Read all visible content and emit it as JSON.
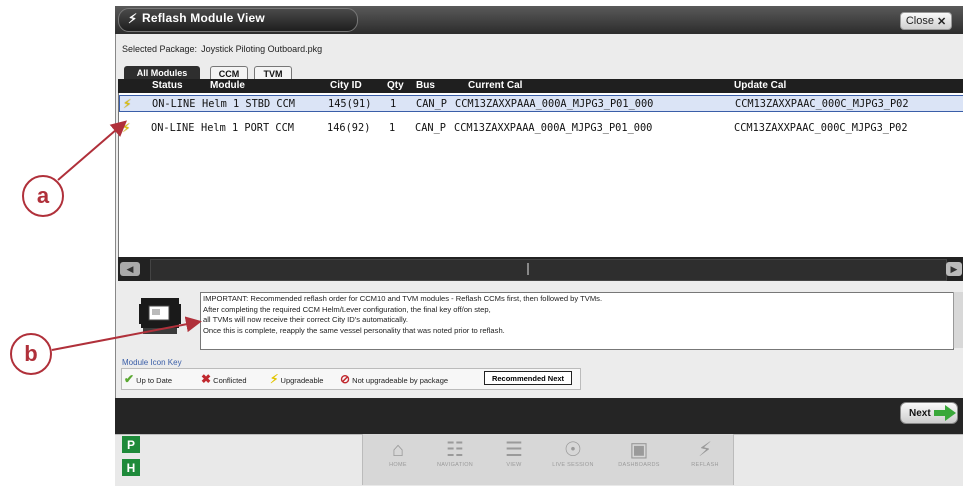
{
  "window": {
    "title": "Reflash Module View",
    "close_label": "Close",
    "selected_package_label": "Selected Package:",
    "selected_package_value": "Joystick Piloting Outboard.pkg"
  },
  "tabs": [
    {
      "label": "All Modules",
      "active": true
    },
    {
      "label": "CCM",
      "active": false
    },
    {
      "label": "TVM",
      "active": false
    }
  ],
  "table": {
    "columns": [
      "Status",
      "Module",
      "City ID",
      "Qty",
      "Bus",
      "Current Cal",
      "Update Cal"
    ],
    "rows": [
      {
        "status_icon": "upgradeable-bolt-icon",
        "status": "ON-LINE",
        "module": "Helm 1 STBD CCM",
        "city_id": "145(91)",
        "qty": "1",
        "bus": "CAN_P",
        "current_cal": "CCM13ZAXXPAAA_000A_MJPG3_P01_000",
        "update_cal": "CCM13ZAXXPAAC_000C_MJPG3_P02",
        "selected": true
      },
      {
        "status_icon": "upgradeable-bolt-icon",
        "status": "ON-LINE",
        "module": "Helm 1 PORT CCM",
        "city_id": "146(92)",
        "qty": "1",
        "bus": "CAN_P",
        "current_cal": "CCM13ZAXXPAAA_000A_MJPG3_P01_000",
        "update_cal": "CCM13ZAXXPAAC_000C_MJPG3_P02",
        "selected": false
      }
    ]
  },
  "important": {
    "lines": [
      "IMPORTANT: Recommended reflash order for CCM10 and TVM modules - Reflash CCMs first, then followed by TVMs.",
      "After completing the required CCM Helm/Lever configuration, the final key off/on step,",
      "all TVMs will now receive their correct City ID's automatically.",
      "Once this is complete, reapply the same vessel personality that was noted prior to reflash."
    ]
  },
  "icon_key": {
    "title": "Module Icon Key",
    "items": [
      {
        "icon": "check-icon",
        "label": "Up to Date",
        "color": "#5aa832"
      },
      {
        "icon": "conflicted-icon",
        "label": "Conflicted",
        "color": "#c0282e"
      },
      {
        "icon": "upgradeable-bolt-icon",
        "label": "Upgradeable",
        "color": "#e2c400"
      },
      {
        "icon": "not-upgradeable-icon",
        "label": "Not upgradeable by package",
        "color": "#c0282e"
      }
    ],
    "recommended_next": "Recommended Next"
  },
  "next_label": "Next",
  "side_buttons": [
    "P",
    "H"
  ],
  "nav": [
    {
      "icon": "home-icon",
      "label": "HOME"
    },
    {
      "icon": "navigation-icon",
      "label": "NAVIGATION"
    },
    {
      "icon": "view-icon",
      "label": "VIEW"
    },
    {
      "icon": "live-session-icon",
      "label": "LIVE SESSION"
    },
    {
      "icon": "dashboards-icon",
      "label": "DASHBOARDS"
    },
    {
      "icon": "reflash-icon",
      "label": "REFLASH"
    }
  ],
  "callouts": {
    "a": "a",
    "b": "b"
  },
  "colors": {
    "accent_green": "#1e8a3a",
    "callout_red": "#b0303a",
    "selection_blue": "#3a5ea8"
  }
}
